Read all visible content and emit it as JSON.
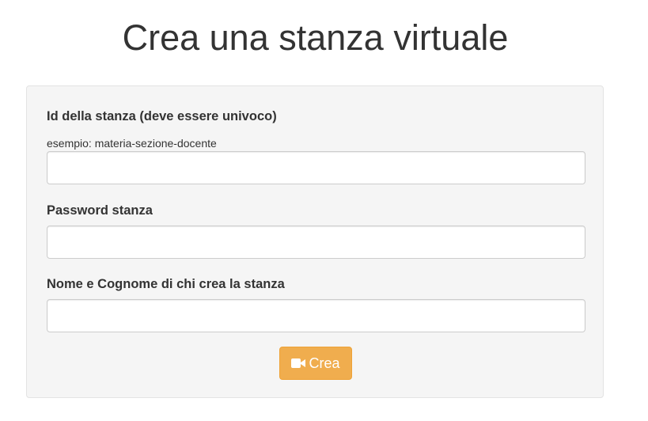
{
  "page": {
    "title": "Crea una stanza virtuale"
  },
  "form": {
    "room_id": {
      "label": "Id della stanza (deve essere univoco)",
      "hint": "esempio: materia-sezione-docente",
      "value": "",
      "placeholder": ""
    },
    "password": {
      "label": "Password stanza",
      "value": "",
      "placeholder": ""
    },
    "creator_name": {
      "label": "Nome e Cognome di chi crea la stanza",
      "value": "",
      "placeholder": ""
    },
    "submit": {
      "label": "Crea",
      "icon": "video-camera-icon",
      "color": "#f0ad4e"
    }
  }
}
